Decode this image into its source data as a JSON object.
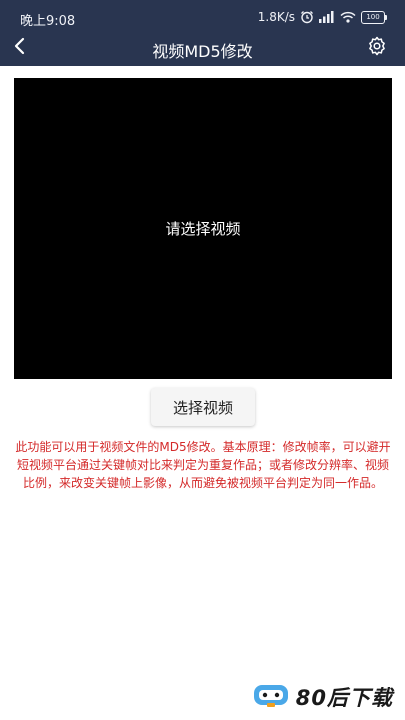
{
  "status_bar": {
    "time": "晚上9:08",
    "network_speed": "1.8K/s",
    "battery": "100"
  },
  "nav": {
    "title": "视频MD5修改"
  },
  "preview": {
    "placeholder": "请选择视频"
  },
  "actions": {
    "select_video_label": "选择视频"
  },
  "description": "此功能可以用于视频文件的MD5修改。基本原理：修改帧率，可以避开短视频平台通过关键帧对比来判定为重复作品；或者修改分辨率、视频比例，来改变关键帧上影像，从而避免被视频平台判定为同一作品。",
  "watermark": {
    "text": "80后下载"
  },
  "colors": {
    "header_bg": "#293550",
    "description_text": "#d42a2a",
    "preview_bg": "#000000"
  }
}
